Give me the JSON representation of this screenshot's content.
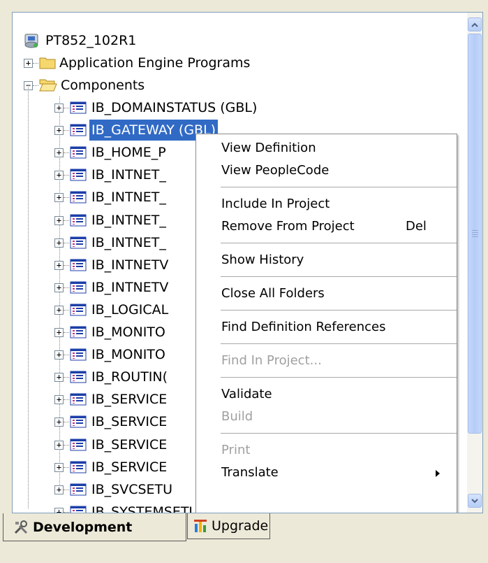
{
  "tree": {
    "root": {
      "label": "PT852_102R1",
      "icon": "database-icon"
    },
    "folders": [
      {
        "label": "Application Engine Programs",
        "expanded": false,
        "icon": "folder-closed-icon"
      },
      {
        "label": "Components",
        "expanded": true,
        "icon": "folder-open-icon"
      }
    ],
    "items": [
      {
        "label": "IB_DOMAINSTATUS (GBL)"
      },
      {
        "label": "IB_GATEWAY (GBL)",
        "selected": true
      },
      {
        "label": "IB_HOME_P"
      },
      {
        "label": "IB_INTNET_"
      },
      {
        "label": "IB_INTNET_"
      },
      {
        "label": "IB_INTNET_"
      },
      {
        "label": "IB_INTNET_"
      },
      {
        "label": "IB_INTNETV"
      },
      {
        "label": "IB_INTNETV"
      },
      {
        "label": "IB_LOGICAL"
      },
      {
        "label": "IB_MONITO"
      },
      {
        "label": "IB_MONITO"
      },
      {
        "label": "IB_ROUTIN("
      },
      {
        "label": "IB_SERVICE"
      },
      {
        "label": "IB_SERVICE"
      },
      {
        "label": "IB_SERVICE"
      },
      {
        "label": "IB_SERVICE"
      },
      {
        "label": "IB_SVCSETU"
      },
      {
        "label": "IB_SYSTEMSETUP (GBL)"
      }
    ]
  },
  "context_menu": {
    "groups": [
      [
        {
          "label": "View Definition",
          "enabled": true
        },
        {
          "label": "View PeopleCode",
          "enabled": true
        }
      ],
      [
        {
          "label": "Include In Project",
          "enabled": true
        },
        {
          "label": "Remove From Project",
          "shortcut": "Del",
          "enabled": true
        }
      ],
      [
        {
          "label": "Show History",
          "enabled": true
        }
      ],
      [
        {
          "label": "Close All Folders",
          "enabled": true
        }
      ],
      [
        {
          "label": "Find Definition References",
          "enabled": true
        }
      ],
      [
        {
          "label": "Find In Project...",
          "enabled": false
        }
      ],
      [
        {
          "label": "Validate",
          "enabled": true
        },
        {
          "label": "Build",
          "enabled": false
        }
      ],
      [
        {
          "label": "Print",
          "enabled": false
        },
        {
          "label": "Translate",
          "enabled": true,
          "submenu": true
        }
      ]
    ]
  },
  "tabs": [
    {
      "label": "Development",
      "active": true,
      "icon": "tools-icon"
    },
    {
      "label": "Upgrade",
      "active": false,
      "icon": "upgrade-icon"
    }
  ],
  "colors": {
    "selection": "#316ac5",
    "component_icon": "#1c3ea8"
  }
}
